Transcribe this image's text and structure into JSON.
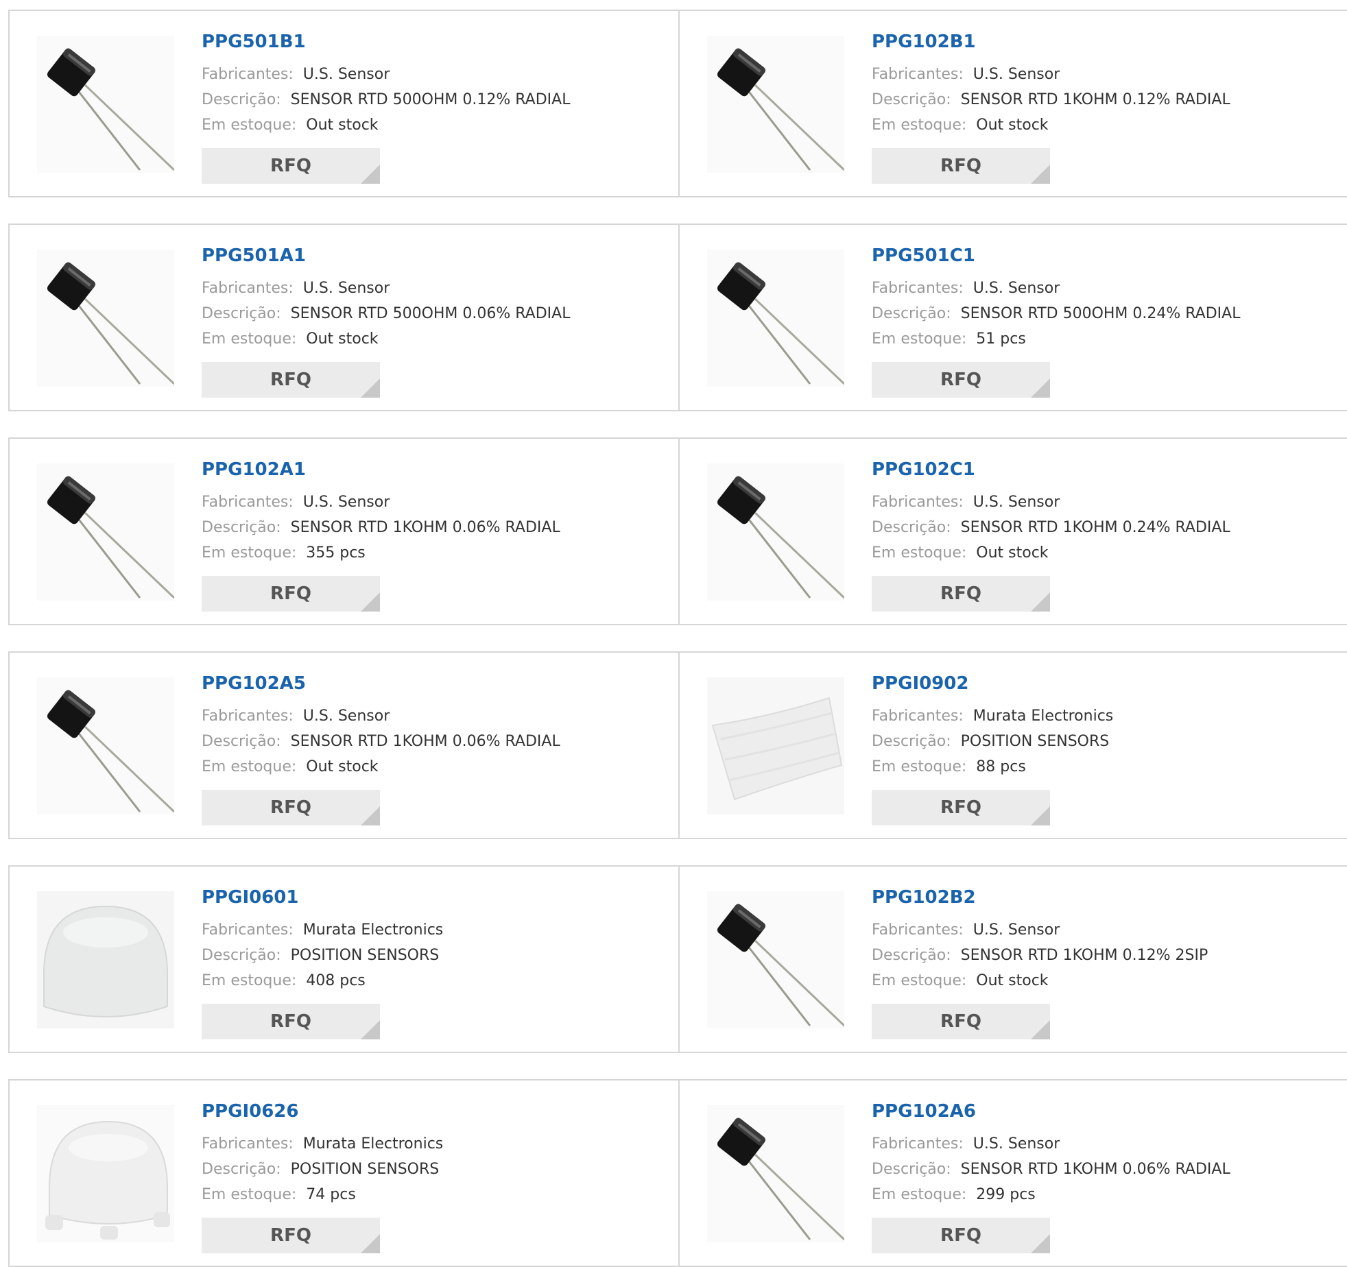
{
  "labels": {
    "manufacturer": "Fabricantes:",
    "description": "Descrição:",
    "stock": "Em estoque:",
    "rfq": "RFQ"
  },
  "products": [
    {
      "part": "PPG501B1",
      "manufacturer": "U.S. Sensor",
      "description": "SENSOR RTD 500OHM 0.12% RADIAL",
      "stock": "Out stock",
      "image": "rtd-sensor-icon"
    },
    {
      "part": "PPG102B1",
      "manufacturer": "U.S. Sensor",
      "description": "SENSOR RTD 1KOHM 0.12% RADIAL",
      "stock": "Out stock",
      "image": "rtd-sensor-icon"
    },
    {
      "part": "PPG501A1",
      "manufacturer": "U.S. Sensor",
      "description": "SENSOR RTD 500OHM 0.06% RADIAL",
      "stock": "Out stock",
      "image": "rtd-sensor-icon"
    },
    {
      "part": "PPG501C1",
      "manufacturer": "U.S. Sensor",
      "description": "SENSOR RTD 500OHM 0.24% RADIAL",
      "stock": "51 pcs",
      "image": "rtd-sensor-icon"
    },
    {
      "part": "PPG102A1",
      "manufacturer": "U.S. Sensor",
      "description": "SENSOR RTD 1KOHM 0.06% RADIAL",
      "stock": "355 pcs",
      "image": "rtd-sensor-icon"
    },
    {
      "part": "PPG102C1",
      "manufacturer": "U.S. Sensor",
      "description": "SENSOR RTD 1KOHM 0.24% RADIAL",
      "stock": "Out stock",
      "image": "rtd-sensor-icon"
    },
    {
      "part": "PPG102A5",
      "manufacturer": "U.S. Sensor",
      "description": "SENSOR RTD 1KOHM 0.06% RADIAL",
      "stock": "Out stock",
      "image": "rtd-sensor-icon"
    },
    {
      "part": "PPGI0902",
      "manufacturer": "Murata Electronics",
      "description": "POSITION SENSORS",
      "stock": "88 pcs",
      "image": "lens-sheet-icon"
    },
    {
      "part": "PPGI0601",
      "manufacturer": "Murata Electronics",
      "description": "POSITION SENSORS",
      "stock": "408 pcs",
      "image": "dome-lens-icon"
    },
    {
      "part": "PPG102B2",
      "manufacturer": "U.S. Sensor",
      "description": "SENSOR RTD 1KOHM 0.12% 2SIP",
      "stock": "Out stock",
      "image": "rtd-sensor-icon"
    },
    {
      "part": "PPGI0626",
      "manufacturer": "Murata Electronics",
      "description": "POSITION SENSORS",
      "stock": "74 pcs",
      "image": "dome-lens-legs-icon"
    },
    {
      "part": "PPG102A6",
      "manufacturer": "U.S. Sensor",
      "description": "SENSOR RTD 1KOHM 0.06% RADIAL",
      "stock": "299 pcs",
      "image": "rtd-sensor-icon"
    }
  ]
}
